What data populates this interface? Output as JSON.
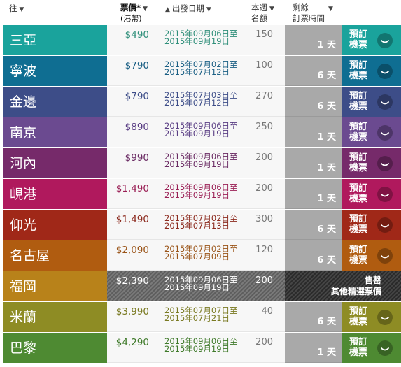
{
  "header": {
    "destination": "往",
    "price_line1": "票價*",
    "price_line2": "(港幣)",
    "date": "出發日期",
    "seats_line1": "本週",
    "seats_line2": "名額",
    "remaining_line1": "剩餘",
    "remaining_line2": "訂票時間",
    "down_arrow": "▼",
    "up_arrow": "▲"
  },
  "book_label": "預訂機票",
  "day_unit": "天",
  "rows": [
    {
      "dest": "三亞",
      "price": "$490",
      "d1": "2015年09月06日至",
      "d2": "2015年09月19日",
      "seats": "150",
      "days": "1",
      "color": "#1aa39c",
      "accent": "#2f8f7a"
    },
    {
      "dest": "寧波",
      "price": "$790",
      "d1": "2015年07月02日至",
      "d2": "2015年07月12日",
      "seats": "100",
      "days": "6",
      "color": "#0f6e92",
      "accent": "#1a5f84"
    },
    {
      "dest": "金邊",
      "price": "$790",
      "d1": "2015年07月03日至",
      "d2": "2015年07月12日",
      "seats": "270",
      "days": "6",
      "color": "#3d4d88",
      "accent": "#3d4d88"
    },
    {
      "dest": "南京",
      "price": "$890",
      "d1": "2015年09月06日至",
      "d2": "2015年09月19日",
      "seats": "250",
      "days": "1",
      "color": "#6b4a90",
      "accent": "#5a3e84"
    },
    {
      "dest": "河內",
      "price": "$990",
      "d1": "2015年09月06日至",
      "d2": "2015年09月19日",
      "seats": "200",
      "days": "1",
      "color": "#762a6a",
      "accent": "#6a2a63"
    },
    {
      "dest": "峴港",
      "price": "$1,490",
      "d1": "2015年09月06日至",
      "d2": "2015年09月19日",
      "seats": "200",
      "days": "1",
      "color": "#b0195d",
      "accent": "#9a1f55"
    },
    {
      "dest": "仰光",
      "price": "$1,490",
      "d1": "2015年07月02日至",
      "d2": "2015年07月13日",
      "seats": "300",
      "days": "6",
      "color": "#a02818",
      "accent": "#8c2a1e"
    },
    {
      "dest": "名古屋",
      "price": "$2,090",
      "d1": "2015年07月02日至",
      "d2": "2015年07月09日",
      "seats": "120",
      "days": "6",
      "color": "#b05c10",
      "accent": "#9a5418"
    },
    {
      "dest": "福岡",
      "price": "$2,390",
      "d1": "2015年09月06日至",
      "d2": "2015年09月19日",
      "seats": "200",
      "soldout": true,
      "sold_line1": "售罄",
      "sold_line2": "其他精選票價",
      "color": "#b8821a",
      "accent": "#ffffff"
    },
    {
      "dest": "米蘭",
      "price": "$3,990",
      "d1": "2015年07月07日至",
      "d2": "2015年07月21日",
      "seats": "40",
      "days": "6",
      "color": "#8e8c24",
      "accent": "#7a7a22"
    },
    {
      "dest": "巴黎",
      "price": "$4,290",
      "d1": "2015年09月06日至",
      "d2": "2015年09月19日",
      "seats": "200",
      "days": "1",
      "color": "#4e8a32",
      "accent": "#3f7a2a"
    }
  ]
}
